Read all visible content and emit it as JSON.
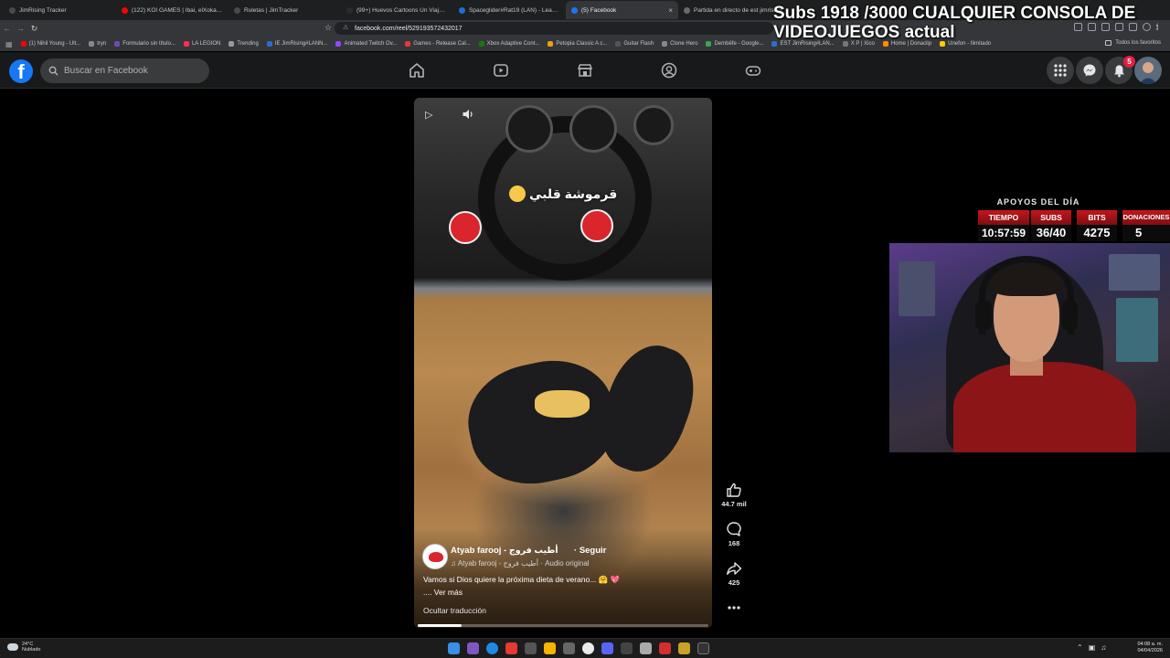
{
  "stream_overlay": {
    "title": "Subs 1918 /3000 CUALQUIER CONSOLA DE VIDEOJUEGOS actual"
  },
  "browser": {
    "tabs": [
      {
        "label": "JimRising Tracker",
        "color": "#4a4a4a"
      },
      {
        "label": "(122) KOI GAMES | Ibai, elXokas y Th",
        "color": "#ff0000"
      },
      {
        "label": "Ruletas | JimTracker",
        "color": "#4a4a4a"
      },
      {
        "label": "(99+) Huevos Cartoons Un Viaje de R",
        "color": "#2a2a2a"
      },
      {
        "label": "Spaceglider#Rat19 (LAN) - LeagueOf",
        "color": "#1b6fd6"
      },
      {
        "label": "(5) Facebook",
        "color": "#1877f2",
        "active": true
      },
      {
        "label": "Partida en directo de est jimrising",
        "color": "#6a6a6a"
      }
    ],
    "url": "facebook.com/reel/529193572432017 ",
    "bookmarks": [
      {
        "label": "(1) Nihil Young - Ult...",
        "color": "#ff0000"
      },
      {
        "label": "tryn",
        "color": "#888888"
      },
      {
        "label": "Formulario sin título...",
        "color": "#7248b9"
      },
      {
        "label": "LA LEGION",
        "color": "#ff2d55"
      },
      {
        "label": "Trending",
        "color": "#999999"
      },
      {
        "label": "IE JimRising#LANN...",
        "color": "#2b6cd4"
      },
      {
        "label": "Animated Twitch Ov...",
        "color": "#9147ff"
      },
      {
        "label": "Games - Release Cal...",
        "color": "#e53935"
      },
      {
        "label": "Xbox Adaptive Cont...",
        "color": "#107c10"
      },
      {
        "label": "Petopia Classic A c...",
        "color": "#f39c12"
      },
      {
        "label": "Guitar Flash",
        "color": "#555555"
      },
      {
        "label": "Clone Hero",
        "color": "#888888"
      },
      {
        "label": "Dembëfe - Google...",
        "color": "#34a853"
      },
      {
        "label": "EST JimRising#LAN...",
        "color": "#2b6cd4"
      },
      {
        "label": "X P | Xico",
        "color": "#777777"
      },
      {
        "label": "Home | Donaclip",
        "color": "#ff8c00"
      },
      {
        "label": "Unefon - Ilimitado",
        "color": "#ffcc00"
      }
    ],
    "all_bookmarks": "Todos los favoritos"
  },
  "facebook": {
    "search_placeholder": "Buscar en Facebook",
    "logo_letter": "f",
    "notification_count": "5"
  },
  "reel": {
    "caption": "قرموشة قلبي",
    "author": "Atyab farooj - أطيب فروج",
    "follow": "Seguir",
    "audio": "Atyab farooj - أطيب فروج · Audio original",
    "description": "Vamos si Dios quiere la próxima dieta de verano... 🤗 💖",
    "see_more": ".... Ver más",
    "hide_translation": "Ocultar traducción",
    "progress": 0.15,
    "likes": "44.7 mil",
    "comments": "168",
    "shares": "425"
  },
  "stream_stats": {
    "title": "APOYOS DEL DÍA",
    "columns": [
      {
        "label": "TIEMPO",
        "value": "10:57:59"
      },
      {
        "label": "SUBS",
        "value": "36/40"
      },
      {
        "label": "BITS",
        "value": "4275"
      },
      {
        "label": "DONACIONES",
        "value": "5"
      }
    ]
  },
  "taskbar": {
    "temperature": "24°C",
    "weather": "Nublado",
    "time": "04:08 a. m.",
    "date": "04/04/2026"
  }
}
